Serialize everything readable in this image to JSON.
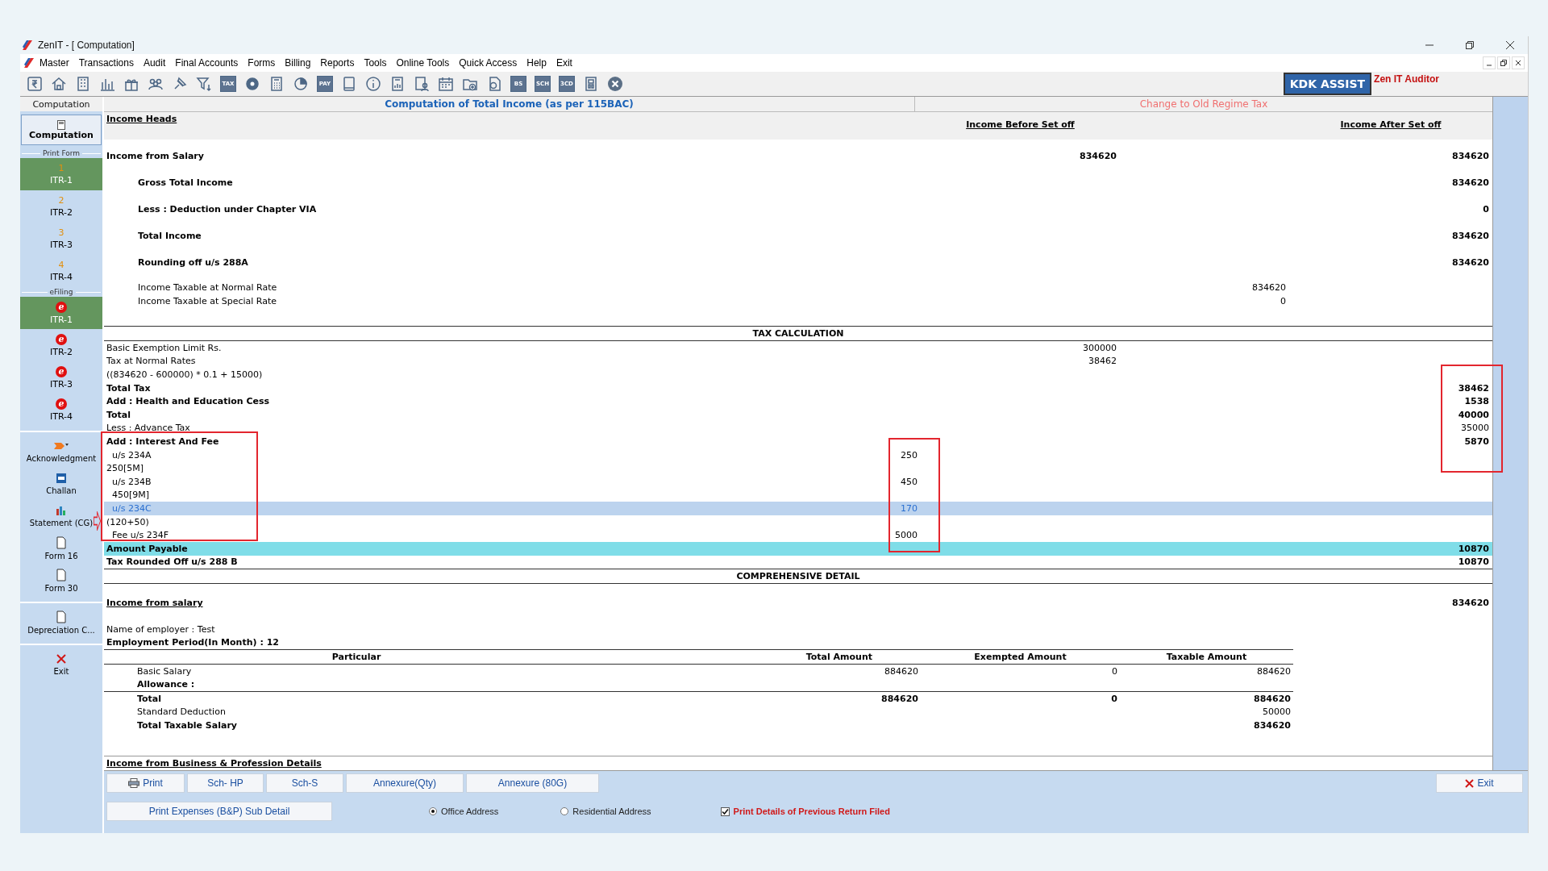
{
  "window": {
    "title": "ZenIT - [ Computation]"
  },
  "menu": [
    "Master",
    "Transactions",
    "Audit",
    "Final Accounts",
    "Forms",
    "Billing",
    "Reports",
    "Tools",
    "Online Tools",
    "Quick Access",
    "Help",
    "Exit"
  ],
  "toolbar": [
    {
      "kind": "rupee"
    },
    {
      "kind": "home"
    },
    {
      "kind": "building"
    },
    {
      "kind": "bars"
    },
    {
      "kind": "gift"
    },
    {
      "kind": "people"
    },
    {
      "kind": "pin"
    },
    {
      "kind": "filter"
    },
    {
      "kind": "text",
      "text": "TAX"
    },
    {
      "kind": "disc"
    },
    {
      "kind": "calculator"
    },
    {
      "kind": "pie"
    },
    {
      "kind": "text",
      "text": "PAY"
    },
    {
      "kind": "book"
    },
    {
      "kind": "info"
    },
    {
      "kind": "report"
    },
    {
      "kind": "user-doc"
    },
    {
      "kind": "calendar"
    },
    {
      "kind": "folder"
    },
    {
      "kind": "doc"
    },
    {
      "kind": "text",
      "text": "BS"
    },
    {
      "kind": "text",
      "text": "SCH"
    },
    {
      "kind": "text",
      "text": "3CD"
    },
    {
      "kind": "grid"
    },
    {
      "kind": "close"
    }
  ],
  "assist_button": "KDK ASSIST",
  "brand": "Zen IT Auditor",
  "sidebar": {
    "tab": "Computation",
    "top_item": "Computation",
    "groups": [
      {
        "title": "Print Form",
        "items": [
          {
            "number": "1",
            "label": "ITR-1",
            "selected": true
          },
          {
            "number": "2",
            "label": "ITR-2",
            "selected": false
          },
          {
            "number": "3",
            "label": "ITR-3",
            "selected": false
          },
          {
            "number": "4",
            "label": "ITR-4",
            "selected": false
          }
        ]
      },
      {
        "title": "eFiling",
        "items": [
          {
            "badge": "e",
            "label": "ITR-1",
            "selected": true
          },
          {
            "badge": "e",
            "label": "ITR-2",
            "selected": false
          },
          {
            "badge": "e",
            "label": "ITR-3",
            "selected": false
          },
          {
            "badge": "e",
            "label": "ITR-4",
            "selected": false
          }
        ]
      }
    ],
    "tools": [
      [
        {
          "label": "Acknowledgment"
        },
        {
          "label": "Challan"
        },
        {
          "label": "Statement (CG)"
        },
        {
          "label": "Form 16"
        },
        {
          "label": "Form 30"
        }
      ],
      [
        {
          "label": "Depreciation C..."
        }
      ],
      [
        {
          "label": "Exit"
        }
      ]
    ]
  },
  "report": {
    "title": "Computation of Total Income (as per 115BAC)",
    "regime_link": "Change to Old Regime Tax",
    "income_heads": {
      "heading": "Income Heads",
      "column_2": "Income Before Set off",
      "column_4": "Income After Set off",
      "rows": [
        {
          "kind": "main",
          "label": "Income from Salary",
          "column_2": "834620",
          "column_4": "834620"
        },
        {
          "kind": "head",
          "label": "Gross Total Income",
          "column_4": "834620"
        },
        {
          "kind": "head",
          "label": "Less : Deduction under Chapter VIA",
          "column_4": "0"
        },
        {
          "kind": "head",
          "label": "Total Income",
          "column_4": "834620"
        },
        {
          "kind": "head",
          "label": "Rounding off u/s 288A",
          "column_4": "834620"
        },
        {
          "kind": "item",
          "label": "Income Taxable at Normal Rate",
          "column_3": "834620"
        },
        {
          "kind": "item",
          "label": "Income Taxable at Special Rate",
          "column_3": "0"
        }
      ]
    },
    "tax_calculation": {
      "title": "TAX CALCULATION",
      "rows": [
        {
          "kind": "item",
          "label": "Basic Exemption Limit Rs.",
          "column_2": "300000",
          "selected": false
        },
        {
          "kind": "item",
          "label": "Tax at Normal Rates",
          "column_2": "38462",
          "selected": false
        },
        {
          "kind": "item",
          "label": "((834620 - 600000) * 0.1 + 15000)",
          "selected": false
        },
        {
          "kind": "sum",
          "label": "Total Tax",
          "column_4": "38462",
          "selected": false
        },
        {
          "kind": "sum",
          "label": "Add : Health and Education Cess",
          "column_4": "1538",
          "selected": false
        },
        {
          "kind": "sum",
          "label": "Total",
          "column_4": "40000",
          "selected": false
        },
        {
          "kind": "item",
          "label": "Less : Advance Tax",
          "column_4": "35000",
          "selected": false
        },
        {
          "kind": "sum",
          "label": "Add : Interest And Fee",
          "column_4": "5870",
          "selected": false
        },
        {
          "kind": "sub",
          "label": "u/s 234A",
          "column_1": "250",
          "selected": false
        },
        {
          "kind": "item",
          "label": "250[5M]",
          "selected": false
        },
        {
          "kind": "sub",
          "label": "u/s 234B",
          "column_1": "450",
          "selected": false
        },
        {
          "kind": "sub",
          "label": "450[9M]",
          "selected": false
        },
        {
          "kind": "sub",
          "label": "u/s 234C",
          "column_1": "170",
          "selected": true
        },
        {
          "kind": "item",
          "label": "(120+50)",
          "selected": false
        },
        {
          "kind": "sub",
          "label": "Fee u/s 234F",
          "column_1": "5000",
          "selected": false
        },
        {
          "kind": "total",
          "label": "Amount Payable",
          "column_4": "10870",
          "selected": false
        },
        {
          "kind": "sum",
          "label": "Tax Rounded Off u/s 288 B",
          "column_4": "10870",
          "selected": false
        }
      ]
    },
    "comprehensive_detail": {
      "title": "COMPREHENSIVE DETAIL",
      "heading": "Income from salary",
      "column_4": "834620",
      "employer": "Name of employer : Test",
      "period": "Employment Period(In Month) : 12",
      "columns": [
        "Particular",
        "Total Amount",
        "Exempted Amount",
        "Taxable Amount"
      ],
      "rows": [
        {
          "kind": "item",
          "particular": "Basic Salary",
          "total_amount": "884620",
          "exempted_amount": "0",
          "taxable_amount": "884620"
        },
        {
          "kind": "sum",
          "particular": "Allowance :"
        },
        {
          "kind": "sum",
          "particular": "Total",
          "total_amount": "884620",
          "exempted_amount": "0",
          "taxable_amount": "884620"
        },
        {
          "kind": "item",
          "particular": "Standard Deduction",
          "taxable_amount": "50000"
        },
        {
          "kind": "sum",
          "particular": "Total Taxable Salary",
          "taxable_amount": "834620"
        }
      ],
      "business_heading": "Income from Business & Profession Details"
    }
  },
  "bottom_bar": {
    "buttons": [
      {
        "label": "Print"
      },
      {
        "label": "Sch- HP"
      },
      {
        "label": "Sch-S"
      },
      {
        "label": "Annexure(Qty)"
      },
      {
        "label": "Annexure (80G)"
      }
    ],
    "exit_button": "Exit",
    "expenses_button": "Print Expenses (B&P) Sub Detail",
    "address_options": [
      {
        "label": "Office Address",
        "selected": true
      },
      {
        "label": "Residential Address",
        "selected": false
      }
    ],
    "print_previous": {
      "label": "Print Details of Previous Return Filed",
      "checked": true
    }
  }
}
